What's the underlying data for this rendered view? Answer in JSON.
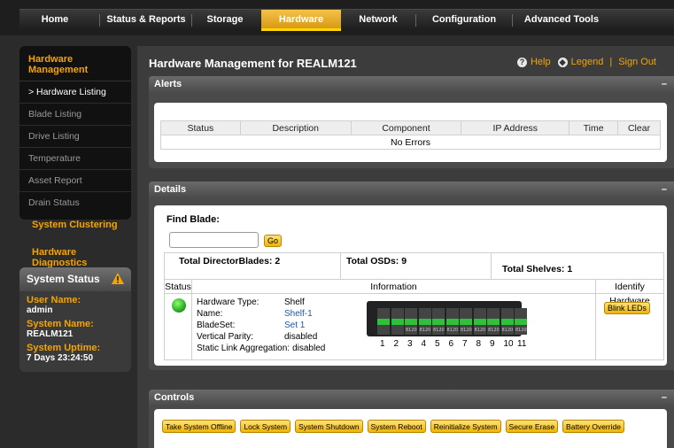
{
  "nav": {
    "tabs": [
      {
        "label": "Home"
      },
      {
        "label": "Status & Reports"
      },
      {
        "label": "Storage"
      },
      {
        "label": "Hardware"
      },
      {
        "label": "Network"
      },
      {
        "label": "Configuration"
      },
      {
        "label": "Advanced Tools"
      }
    ],
    "active_tab": "Hardware"
  },
  "sidebar": {
    "section_title": "Hardware Management",
    "items": [
      {
        "label": "> Hardware Listing"
      },
      {
        "label": "Blade Listing"
      },
      {
        "label": "Drive Listing"
      },
      {
        "label": "Temperature"
      },
      {
        "label": "Asset Report"
      },
      {
        "label": "Drain Status"
      }
    ],
    "links": [
      {
        "label": "System Clustering"
      },
      {
        "label": "Hardware Diagnostics"
      }
    ]
  },
  "system_status": {
    "title": "System Status",
    "user_label": "User Name:",
    "user_value": "admin",
    "name_label": "System Name:",
    "name_value": "REALM121",
    "uptime_label": "System Uptime:",
    "uptime_value": "7 Days 23:24:50"
  },
  "header": {
    "title": "Hardware Management for REALM121",
    "help": "Help",
    "legend": "Legend",
    "signout": "Sign Out"
  },
  "alerts": {
    "title": "Alerts",
    "collapse": "–",
    "columns": [
      "Status",
      "Description",
      "Component",
      "IP Address",
      "Time",
      "Clear"
    ],
    "empty_text": "No Errors"
  },
  "details": {
    "title": "Details",
    "collapse": "–",
    "find_label": "Find Blade:",
    "find_value": "",
    "go_label": "Go",
    "total_directors": "Total DirectorBlades: 2",
    "total_osds": "Total OSDs: 9",
    "total_shelves": "Total Shelves: 1",
    "col_status": "Status",
    "col_information": "Information",
    "col_identify": "Identify Hardware",
    "hw_type_label": "Hardware Type:",
    "hw_type_value": "Shelf",
    "name_label": "Name:",
    "name_value": "Shelf-1",
    "bladeset_label": "BladeSet:",
    "bladeset_value": "Set 1",
    "vparity_label": "Vertical Parity:",
    "vparity_value": "disabled",
    "sla_label": "Static Link Aggregation:",
    "sla_value": "disabled",
    "blink_label": "Blink LEDs",
    "slot_numbers": [
      "1",
      "2",
      "3",
      "4",
      "5",
      "6",
      "7",
      "8",
      "9",
      "10",
      "11"
    ],
    "slot_labels": [
      "",
      "",
      "8120",
      "8120",
      "8120",
      "8120",
      "8120",
      "8120",
      "8120",
      "8120",
      "8120"
    ],
    "led_color": "#2ec23a"
  },
  "controls": {
    "title": "Controls",
    "collapse": "–",
    "buttons": [
      {
        "label": "Take System Offline"
      },
      {
        "label": "Lock System"
      },
      {
        "label": "System Shutdown"
      },
      {
        "label": "System Reboot"
      },
      {
        "label": "Reinitialize System"
      },
      {
        "label": "Secure Erase"
      },
      {
        "label": "Battery Override"
      }
    ]
  },
  "colors": {
    "accent": "#f5a400",
    "active_tab": "#e8a820",
    "link_blue": "#1a5aa8",
    "status_green": "#1e9a1e"
  }
}
